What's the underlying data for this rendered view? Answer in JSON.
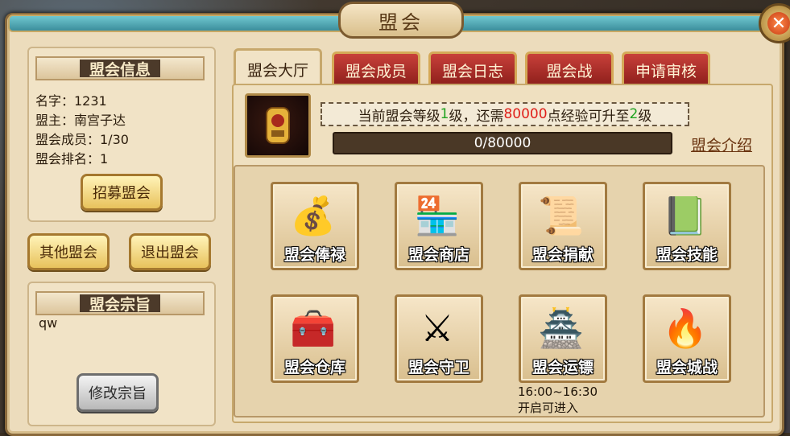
{
  "window": {
    "title": "盟会",
    "close_icon": "close-icon"
  },
  "info": {
    "header": "盟会信息",
    "name": "名字：1231",
    "leader": "盟主：南宫子达",
    "members": "盟会成员：1/30",
    "rank": "盟会排名：1",
    "recruit_button": "招募盟会"
  },
  "actions": {
    "other_guilds": "其他盟会",
    "quit_guild": "退出盟会"
  },
  "purpose": {
    "header": "盟会宗旨",
    "text": "qw",
    "edit_button": "修改宗旨"
  },
  "tabs": [
    {
      "label": "盟会大厅",
      "active": true
    },
    {
      "label": "盟会成员",
      "active": false
    },
    {
      "label": "盟会日志",
      "active": false
    },
    {
      "label": "盟会战",
      "active": false
    },
    {
      "label": "申请审核",
      "active": false
    }
  ],
  "hall": {
    "level_prefix": "当前盟会等级",
    "level": "1",
    "level_mid": "级，还需",
    "xp_needed": "80000",
    "level_mid2": "点经验可升至",
    "next_level": "2",
    "level_suffix": "级",
    "xp_display": "0/80000",
    "xp_fraction": 0,
    "intro_link": "盟会介绍"
  },
  "features": [
    {
      "label": "盟会俸禄",
      "icon": "money-bag-icon"
    },
    {
      "label": "盟会商店",
      "icon": "shop-icon"
    },
    {
      "label": "盟会捐献",
      "icon": "donate-book-icon"
    },
    {
      "label": "盟会技能",
      "icon": "skill-book-icon"
    },
    {
      "label": "盟会仓库",
      "icon": "treasure-chest-icon"
    },
    {
      "label": "盟会守卫",
      "icon": "crossed-swords-shield-icon"
    },
    {
      "label": "盟会运镖",
      "icon": "burning-fortress-icon"
    },
    {
      "label": "盟会城战",
      "icon": "city-war-icon"
    }
  ],
  "escort_time": {
    "time": "16:00~16:30",
    "note": "开启可进入"
  },
  "colors": {
    "accent_red": "#e0201a",
    "accent_green": "#1fa31f",
    "panel": "#ecdcbc"
  }
}
